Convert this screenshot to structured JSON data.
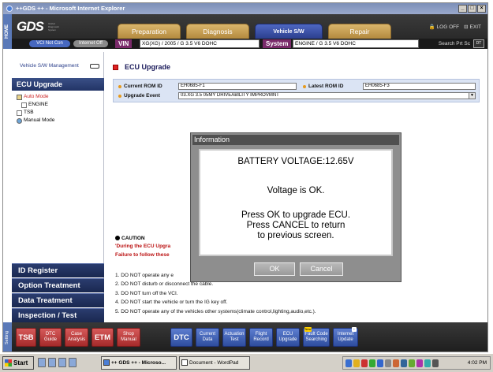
{
  "window": {
    "title": "++GDS ++ - Microsoft Internet Explorer",
    "min": "_",
    "max": "□",
    "close": "×"
  },
  "header": {
    "home_label": "HOME",
    "logo_text": "GDS",
    "logo_sub": "Global Diagnostic System",
    "tabs": [
      "Preparation",
      "Diagnosis",
      "Vehicle S/W Management",
      "Repair"
    ],
    "log_off": "LOG OFF",
    "exit": "EXIT"
  },
  "vehicle_bar": {
    "pill_a": "VCI Not Con",
    "pill_b": "Internet Off",
    "vin_label": "VIN",
    "vin_value": "XG(XG) / 2005 / G 3.5 V6 DOHC",
    "system_label": "System",
    "system_value": "ENGINE / G 3.5 V6 DOHC",
    "search": "Search",
    "print": "Prt Sc",
    "dt_icon": "DT"
  },
  "sidebar": {
    "top_label": "Vehicle S/W Management",
    "section_title": "ECU Upgrade",
    "tree": [
      {
        "label": "Auto Mode",
        "icon": "folder-icon",
        "selected": true
      },
      {
        "label": "ENGINE",
        "icon": "document-icon",
        "selected": false
      },
      {
        "label": "TSB",
        "icon": "document-icon",
        "selected": false
      },
      {
        "label": "Manual Mode",
        "icon": "globe-icon",
        "selected": false
      }
    ],
    "buttons": [
      "ID Register",
      "Option Treatment",
      "Data Treatment",
      "Inspection / Test"
    ]
  },
  "main": {
    "title": "ECU Upgrade",
    "current_rom_label": "Current ROM ID",
    "current_rom_value": "EH0685-F1",
    "latest_rom_label": "Latest ROM ID",
    "latest_rom_value": "EH0685-F3",
    "upgrade_event_label": "Upgrade Event",
    "upgrade_event_value": "03.XG 3.5 05MY DRIVEABILITY IMPROVMNT",
    "dropdown_arrow": "▼",
    "caution_title": "CAUTION",
    "caution_line1": "'During the ECU Upgra",
    "caution_line2": "Failure to follow these",
    "notes": [
      "1. DO NOT operate any e",
      "2. DO NOT disturb or disconnect the cable.",
      "3. DO NOT turn off the VCI.",
      "4. DO NOT start the vehicle or turn the IG key off.",
      "5. DO NOT operate any of the vehicles other systems(climate control,lighting,audio,etc.)."
    ]
  },
  "dialog": {
    "title": "Information",
    "voltage": "BATTERY VOLTAGE:12.65V",
    "status": "Voltage is OK.",
    "line1": "Press OK to upgrade ECU.",
    "line2": "Press CANCEL to return",
    "line3": "to previous screen.",
    "ok": "OK",
    "cancel": "Cancel"
  },
  "toolbar": {
    "setting_label": "Setting",
    "red_buttons": [
      "TSB",
      "DTC Guide",
      "Case Analysis",
      "ETM",
      "Shop Manual"
    ],
    "blue_buttons": [
      "DTC",
      "Current Data",
      "Actuation Test",
      "Flight Record",
      "ECU Upgrade",
      "Fault Code Searching",
      "Internet Update"
    ],
    "badge_new": "New",
    "badge_info": "i"
  },
  "taskbar": {
    "start": "Start",
    "task1": "++ GDS ++ - Microso...",
    "task2": "Document - WordPad",
    "clock": "4:02 PM"
  }
}
